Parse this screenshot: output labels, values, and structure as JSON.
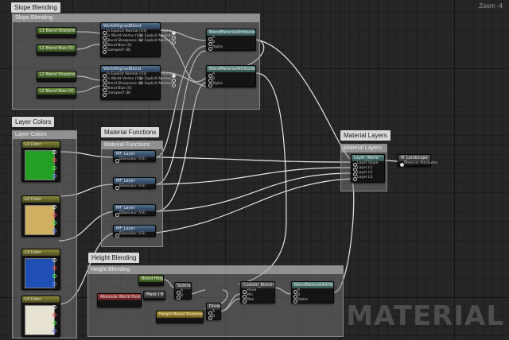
{
  "zoom": "Zoom -4",
  "watermark": "MATERIAL",
  "colors": {
    "green": "#23a023",
    "yellow": "#cfb060",
    "blue": "#1f4fb4",
    "white": "#e8e2d2"
  },
  "comments": {
    "slope": {
      "label": "Slope Blending",
      "header": "Slope Blending"
    },
    "layer_colors": {
      "label": "Layer Colors",
      "header": "Layer Colors"
    },
    "mat_funcs": {
      "label": "Material Functions",
      "header": "Material Functions"
    },
    "mat_layers": {
      "label": "Material Layers",
      "header": "Material Layers"
    },
    "height": {
      "label": "Height Blending",
      "header": "Height Blending"
    }
  },
  "slope_nodes": {
    "blend_sharp_1": {
      "title": "L1 Blend Sharpness (S)",
      "sub": "Param (0.00)"
    },
    "blend_bias_1": {
      "title": "L1 Blend Bias (S)",
      "sub": "Param (0.00)"
    },
    "blend_sharp_2": {
      "title": "L2 Blend Sharpness (S)",
      "sub": "Param (0.00)"
    },
    "blend_bias_2": {
      "title": "L2 Blend Bias (S)",
      "sub": "Param (0.00)"
    },
    "world_aligned_1": {
      "title": "WorldAlignedBlend",
      "inputs": [
        "In Explicit Normal (V3)",
        "In World Vertex (V3)",
        "Blend Sharpness (S)",
        "Blend Bias (S)",
        "Clamped? (B)",
        "Alpha (S)"
      ],
      "outputs": [
        "Alpha",
        "w/ Explicit Normal",
        "w/ Explicit Normal"
      ]
    },
    "world_aligned_2": {
      "title": "WorldAlignedBlend",
      "inputs": [
        "In Explicit Normal (V3)",
        "In World Vertex (V3)",
        "Blend Sharpness (S)",
        "Blend Bias (S)",
        "Clamped? (B)",
        "Alpha (S)"
      ],
      "outputs": [
        "Alpha",
        "w/ Explicit Normal",
        "w/ Explicit Normal"
      ]
    },
    "blend_attr_1": {
      "title": "BlendMaterialAttributes",
      "inputs": [
        "A",
        "B",
        "Alpha"
      ]
    },
    "blend_attr_2": {
      "title": "BlendMaterialAttributes",
      "inputs": [
        "A",
        "B",
        "Alpha"
      ]
    }
  },
  "layer_colors": [
    {
      "title": "L1 Color",
      "sub": "Param (0,0.5,0,1)",
      "color": "green"
    },
    {
      "title": "L2 Color",
      "sub": "Param (0.6,0.5,0.2,1)",
      "color": "yellow"
    },
    {
      "title": "L3 Color",
      "sub": "Param (0,0.1,0.5,1)",
      "color": "blue"
    },
    {
      "title": "L4 Color",
      "sub": "Param (0.9,0.9,0.8,1)",
      "color": "white"
    }
  ],
  "mf_nodes": [
    {
      "title": "MF_Layer",
      "input": "Basecolor (V3)",
      "output": "Result"
    },
    {
      "title": "MF_Layer",
      "input": "Basecolor (V3)",
      "output": "Result"
    },
    {
      "title": "MF_Layer",
      "input": "Basecolor (V3)",
      "output": "Result"
    },
    {
      "title": "MF_Layer",
      "input": "Basecolor (V3)",
      "output": "Result"
    }
  ],
  "layers_node": {
    "title": "Layer_World",
    "inputs": [
      "Layer Slope",
      "Layer L1",
      "Layer L2",
      "Layer L3"
    ]
  },
  "output_node": {
    "title": "M_Landscape",
    "input": "Material Attributes"
  },
  "height_nodes": {
    "blend_height": {
      "title": "Blend Height",
      "sub": "Param (0)"
    },
    "abs_world_pos": {
      "title": "Absolute World Position",
      "sub": "Excluding Offsets"
    },
    "mask": {
      "title": "Mask ( B )"
    },
    "subtract": {
      "title": "Subtract",
      "inputs": [
        "A",
        "B"
      ]
    },
    "height_sharp": {
      "title": "Height Blend Sharpness",
      "sub": "Param (0)"
    },
    "divide": {
      "title": "Divide",
      "inputs": [
        "A",
        "B"
      ]
    },
    "smoothstep": {
      "title": "Custom_Blend (Height)",
      "inputs": [
        "Value",
        "Min",
        "Max"
      ]
    },
    "blend_attr_3": {
      "title": "BlendMaterialAttributes",
      "inputs": [
        "A",
        "B",
        "Alpha"
      ]
    }
  }
}
